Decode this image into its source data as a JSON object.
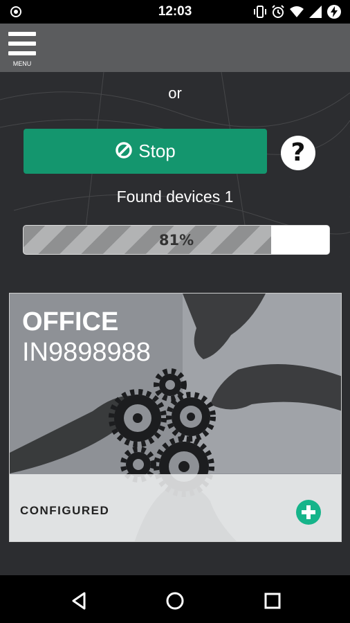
{
  "status_bar": {
    "time": "12:03",
    "icons": [
      "sync-icon",
      "vibrate-icon",
      "alarm-icon",
      "wifi-icon",
      "signal-icon",
      "battery-charging-icon"
    ]
  },
  "app_bar": {
    "menu_label": "MENU",
    "menu_icon": "hamburger-menu-icon"
  },
  "main": {
    "or_text": "or",
    "stop_button": {
      "label": "Stop",
      "icon": "stop-circle-icon",
      "color": "#14966e"
    },
    "help_button": {
      "label": "?",
      "icon": "help-icon"
    },
    "found_devices_text": "Found devices 1",
    "progress": {
      "value": 0.81,
      "label": "81%"
    }
  },
  "device_card": {
    "name": "OFFICE",
    "serial": "IN9898988",
    "status": "CONFIGURED",
    "action_icon": "add-circle-icon",
    "accent_color": "#16b48a"
  },
  "nav_bar": {
    "icons": [
      "back-icon",
      "home-icon",
      "recents-icon"
    ]
  }
}
